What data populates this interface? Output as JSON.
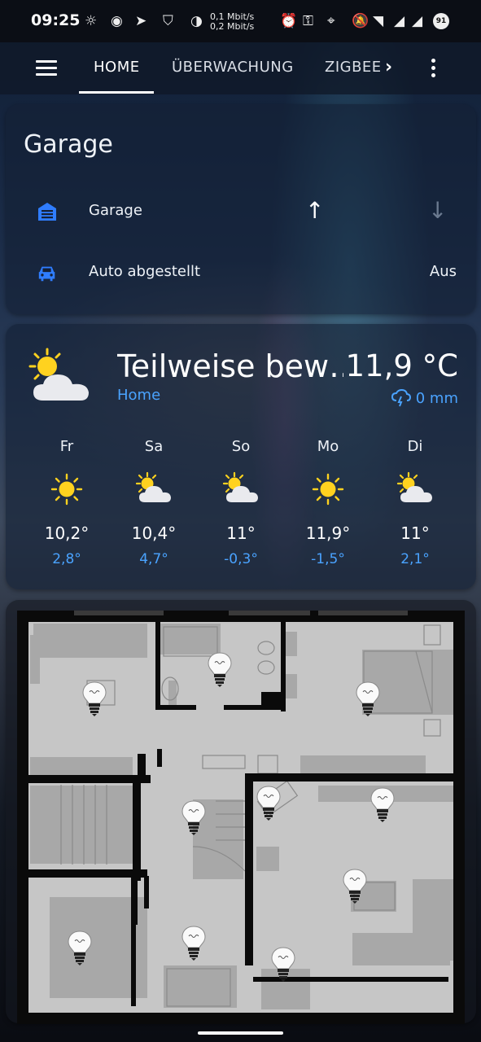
{
  "status": {
    "time": "09:25",
    "net_up": "0,1 Mbit/s",
    "net_down": "0,2 Mbit/s",
    "battery": "91"
  },
  "tabs": [
    {
      "label": "HOME"
    },
    {
      "label": "ÜBERWACHUNG"
    },
    {
      "label": "ZIGBEE"
    }
  ],
  "garage": {
    "title": "Garage",
    "rows": [
      {
        "label": "Garage",
        "icon": "garage-door-icon"
      },
      {
        "label": "Auto abgestellt",
        "icon": "car-icon",
        "state": "Aus"
      }
    ]
  },
  "weather": {
    "condition": "Teilweise bew…",
    "location": "Home",
    "temperature": "11,9 °C",
    "precipitation": "0 mm",
    "forecast": [
      {
        "day": "Fr",
        "high": "10,2°",
        "low": "2,8°",
        "icon": "sunny"
      },
      {
        "day": "Sa",
        "high": "10,4°",
        "low": "4,7°",
        "icon": "partly-cloudy"
      },
      {
        "day": "So",
        "high": "11°",
        "low": "-0,3°",
        "icon": "partly-cloudy"
      },
      {
        "day": "Mo",
        "high": "11,9°",
        "low": "-1,5°",
        "icon": "sunny"
      },
      {
        "day": "Di",
        "high": "11°",
        "low": "2,1°",
        "icon": "partly-cloudy"
      }
    ]
  },
  "colors": {
    "accent": "#4aa3ff",
    "garage_icon": "#2f7dff",
    "sun": "#ffd21f",
    "cloud": "#e9eaee"
  }
}
